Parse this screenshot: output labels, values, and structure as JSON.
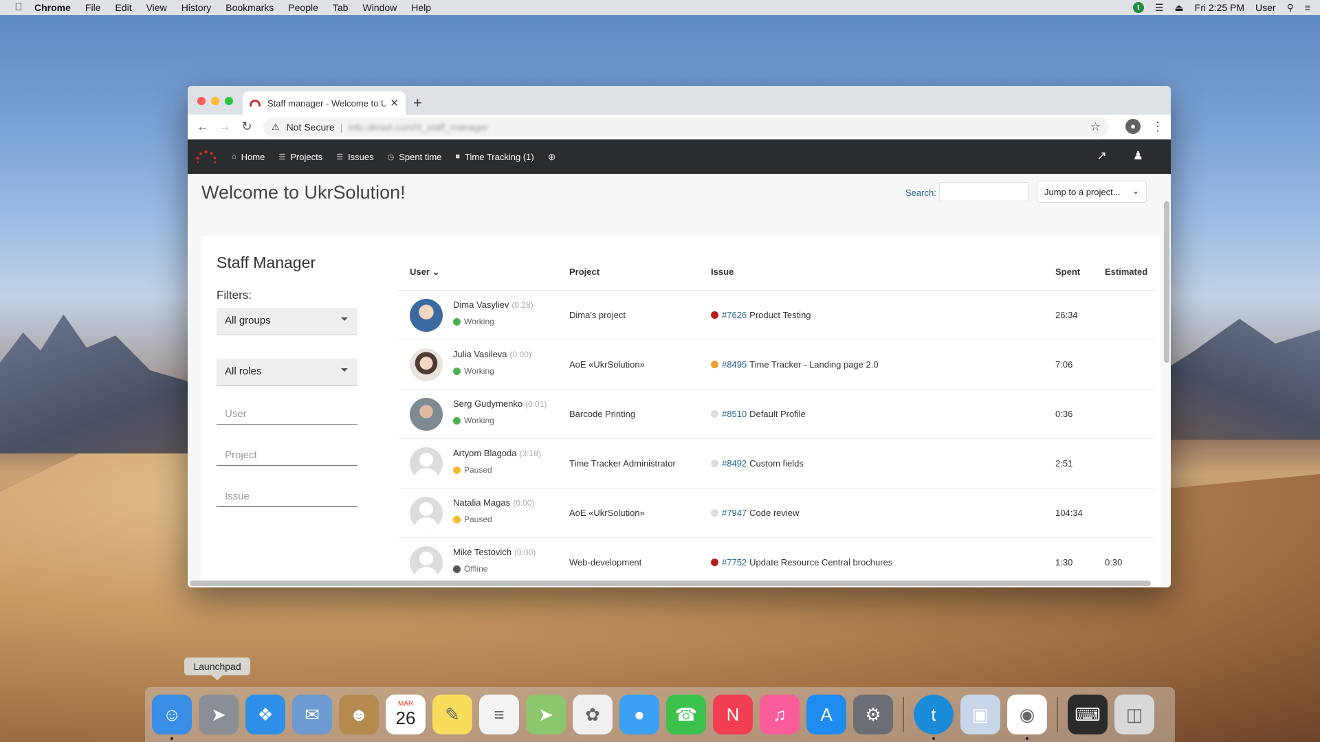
{
  "menubar": {
    "app": "Chrome",
    "items": [
      "File",
      "Edit",
      "View",
      "History",
      "Bookmarks",
      "People",
      "Tab",
      "Window",
      "Help"
    ],
    "clock": "Fri 2:25 PM",
    "user": "User",
    "tt_badge": "t"
  },
  "browser": {
    "tab_title": "Staff manager - Welcome to U",
    "new_tab": "+",
    "security_label": "Not Secure",
    "url": "info.ukrsol.com/rt_staff_manager"
  },
  "nav": {
    "home": "Home",
    "projects": "Projects",
    "issues": "Issues",
    "spent_time": "Spent time",
    "time_tracking": "Time Tracking (1)"
  },
  "header": {
    "title": "Welcome to UkrSolution!",
    "search_label": "Search:",
    "jump_label": "Jump to a project..."
  },
  "sidebar": {
    "title": "Staff Manager",
    "filters_label": "Filters:",
    "groups_select": "All groups",
    "roles_select": "All roles",
    "user_placeholder": "User",
    "project_placeholder": "Project",
    "issue_placeholder": "Issue"
  },
  "table": {
    "columns": [
      "User",
      "Project",
      "Issue",
      "Spent",
      "Estimated"
    ],
    "rows": [
      {
        "name": "Dima Vasyliev",
        "duration": "(0:28)",
        "status": "Working",
        "status_color": "#4cb050",
        "project": "Dima's project",
        "issue_num": "#7626",
        "issue_title": "Product Testing",
        "priority_color": "#b71c1c",
        "spent": "26:34",
        "estimated": "",
        "avatar": "photo1"
      },
      {
        "name": "Julia Vasileva",
        "duration": "(0:00)",
        "status": "Working",
        "status_color": "#4cb050",
        "project": "AoE «UkrSolution»",
        "issue_num": "#8495",
        "issue_title": "Time Tracker - Landing page 2.0",
        "priority_color": "#f39c33",
        "spent": "7:06",
        "estimated": "",
        "avatar": "photo2"
      },
      {
        "name": "Serg Gudymenko",
        "duration": "(0:01)",
        "status": "Working",
        "status_color": "#4cb050",
        "project": "Barcode Printing",
        "issue_num": "#8510",
        "issue_title": "Default Profile",
        "priority_color": "#dddddd",
        "spent": "0:36",
        "estimated": "",
        "avatar": "photo3"
      },
      {
        "name": "Artyom Blagoda",
        "duration": "(3:18)",
        "status": "Paused",
        "status_color": "#f5b932",
        "project": "Time Tracker Administrator",
        "issue_num": "#8492",
        "issue_title": "Custom fields",
        "priority_color": "#dddddd",
        "spent": "2:51",
        "estimated": "",
        "avatar": "default"
      },
      {
        "name": "Natalia Magas",
        "duration": "(0:00)",
        "status": "Paused",
        "status_color": "#f5b932",
        "project": "AoE «UkrSolution»",
        "issue_num": "#7947",
        "issue_title": "Code review",
        "priority_color": "#dddddd",
        "spent": "104:34",
        "estimated": "",
        "avatar": "default"
      },
      {
        "name": "Mike Testovich",
        "duration": "(0:00)",
        "status": "Offline",
        "status_color": "#555555",
        "project": "Web-development",
        "issue_num": "#7752",
        "issue_title": "Update Resource Central brochures",
        "priority_color": "#b71c1c",
        "spent": "1:30",
        "estimated": "0:30",
        "avatar": "default"
      }
    ]
  },
  "dock": {
    "tooltip": "Launchpad",
    "calendar_month": "MAR",
    "calendar_day": "26",
    "apps": [
      {
        "name": "finder",
        "color": "#3a8ee6"
      },
      {
        "name": "launchpad",
        "color": "#8a8f96"
      },
      {
        "name": "safari",
        "color": "#2d8fe8"
      },
      {
        "name": "mail",
        "color": "#6c9ad1"
      },
      {
        "name": "contacts",
        "color": "#b48a4f"
      },
      {
        "name": "calendar",
        "color": "#ffffff"
      },
      {
        "name": "notes",
        "color": "#f7dd5b"
      },
      {
        "name": "reminders",
        "color": "#f4f4f4"
      },
      {
        "name": "maps",
        "color": "#8cc66d"
      },
      {
        "name": "photos",
        "color": "#f0f0f0"
      },
      {
        "name": "messages",
        "color": "#3aa0f3"
      },
      {
        "name": "facetime",
        "color": "#3ac24d"
      },
      {
        "name": "news",
        "color": "#f13e50"
      },
      {
        "name": "itunes",
        "color": "#fb5c9a"
      },
      {
        "name": "app-store",
        "color": "#1e8cf0"
      },
      {
        "name": "system-preferences",
        "color": "#6b6f75"
      },
      {
        "name": "time-tracker",
        "color": "#1a8bd8"
      },
      {
        "name": "preview",
        "color": "#c7d6e8"
      },
      {
        "name": "chrome",
        "color": "#ffffff"
      },
      {
        "name": "terminal",
        "color": "#2b2b2b"
      },
      {
        "name": "trash",
        "color": "#d9d9d9"
      }
    ]
  }
}
